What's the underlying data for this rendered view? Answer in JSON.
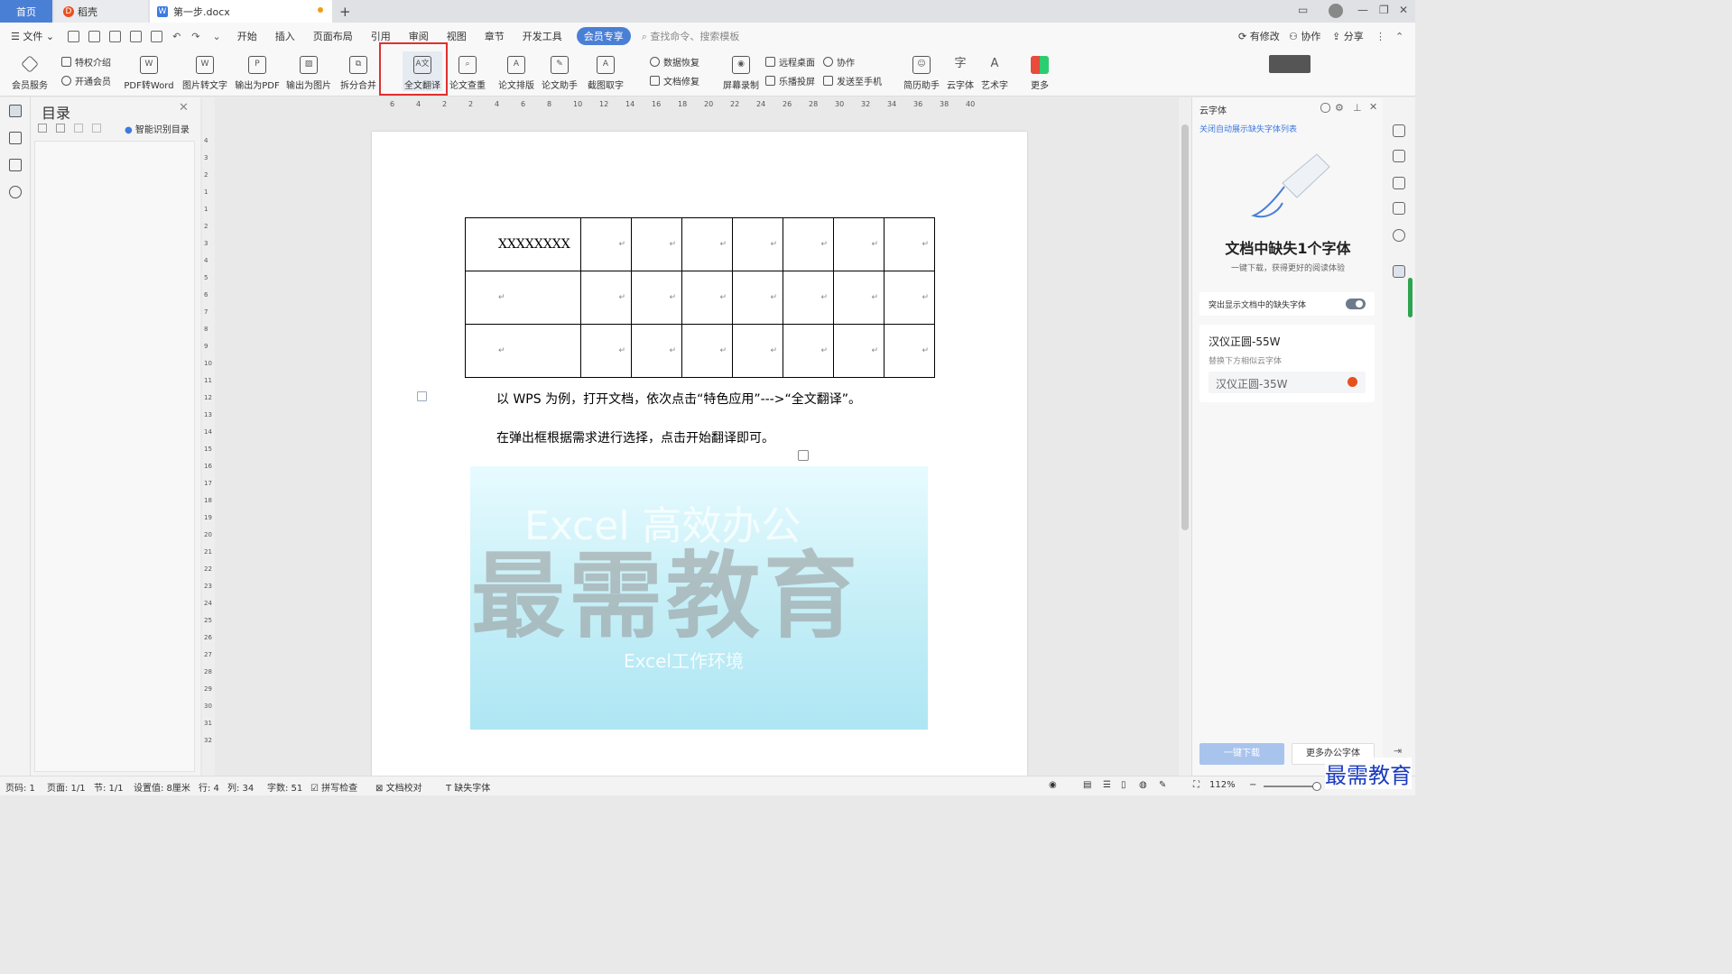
{
  "tabs": {
    "home": "首页",
    "daoke": "稻壳",
    "document": "第一步.docx",
    "add": "+"
  },
  "menu": {
    "file": "文件",
    "items": [
      "开始",
      "插入",
      "页面布局",
      "引用",
      "审阅",
      "视图",
      "章节",
      "开发工具",
      "会员专享"
    ],
    "search": "查找命令、搜索模板",
    "modified": "有修改",
    "collaborate": "协作",
    "share": "分享"
  },
  "ribbon": {
    "member_service": "会员服务",
    "privilege": "特权介绍",
    "open_member": "开通会员",
    "pdf_to_word": "PDF转Word",
    "image_to_text": "图片转文字",
    "export_pdf": "输出为PDF",
    "export_image": "输出为图片",
    "split_merge": "拆分合并",
    "full_translate": "全文翻译",
    "paper_check": "论文查重",
    "paper_layout": "论文排版",
    "paper_assistant": "论文助手",
    "screenshot_ocr": "截图取字",
    "data_recovery": "数据恢复",
    "doc_repair": "文档修复",
    "screen_record": "屏幕录制",
    "remote_desktop": "远程桌面",
    "lepro_cast": "乐播投屏",
    "collab": "协作",
    "send_phone": "发送至手机",
    "resume": "简历助手",
    "cloud_font": "云字体",
    "art_font": "艺术字",
    "more": "更多"
  },
  "toc": {
    "title": "目录",
    "smart": "智能识别目录"
  },
  "document": {
    "table_first_cell": "XXXXXXXX",
    "para1": "以 WPS 为例，打开文档，依次点击“特色应用”--->“全文翻译”。",
    "para2": "在弹出框根据需求进行选择，点击开始翻译即可。",
    "watermark": "最需教育",
    "banner_text_top": "Excel 高效办公",
    "banner_text_bottom": "Excel工作环境"
  },
  "ruler": {
    "h_ticks": [
      "6",
      "4",
      "2",
      "2",
      "4",
      "6",
      "8",
      "10",
      "12",
      "14",
      "16",
      "18",
      "20",
      "22",
      "24",
      "26",
      "28",
      "30",
      "32",
      "34",
      "36",
      "38",
      "40"
    ],
    "v_ticks": [
      "4",
      "3",
      "2",
      "1",
      "1",
      "2",
      "3",
      "4",
      "5",
      "6",
      "7",
      "8",
      "9",
      "10",
      "11",
      "12",
      "13",
      "14",
      "15",
      "16",
      "17",
      "18",
      "19",
      "20",
      "21",
      "22",
      "23",
      "24",
      "25",
      "26",
      "27",
      "28",
      "29",
      "30",
      "31",
      "32"
    ]
  },
  "right_panel": {
    "header": "云字体",
    "close_link": "关闭自动展示缺失字体列表",
    "title": "文档中缺失1个字体",
    "subtitle": "一键下载，获得更好的阅读体验",
    "toggle_label": "突出显示文档中的缺失字体",
    "missing_font": "汉仪正圆-55W",
    "replace_hint": "替换下方相似云字体",
    "similar_font": "汉仪正圆-35W",
    "download_btn": "一键下载",
    "more_btn": "更多办公字体"
  },
  "status": {
    "page_code": "页码: 1",
    "page": "页面: 1/1",
    "section": "节: 1/1",
    "setting": "设置值: 8厘米",
    "row": "行: 4",
    "col": "列: 34",
    "words": "字数: 51",
    "spell": "拼写检查",
    "proof": "文档校对",
    "missing_font": "缺失字体",
    "zoom": "112%"
  },
  "brand_watermark": "最需教育",
  "colors": {
    "accent": "#4a7fd6",
    "highlight": "#e03030",
    "missing_icon": "#e8501f"
  }
}
